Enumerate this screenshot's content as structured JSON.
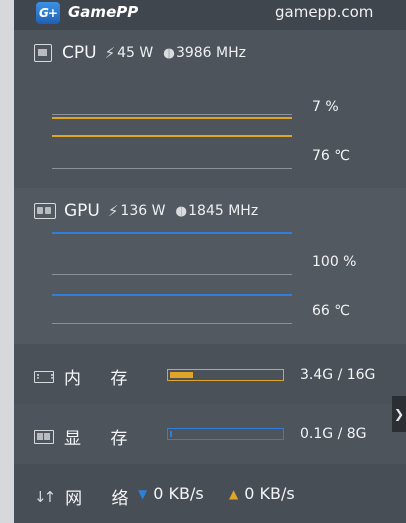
{
  "header": {
    "logo_badge": "G+",
    "logo_text": "GamePP",
    "site": "gamepp.com"
  },
  "cpu": {
    "label": "CPU",
    "power": "45 W",
    "clock": "3986 MHz",
    "usage_text": "7 %",
    "temp_text": "76 ℃",
    "usage_color": "#e0a427",
    "temp_color": "#e0a427"
  },
  "gpu": {
    "label": "GPU",
    "power": "136 W",
    "clock": "1845 MHz",
    "usage_text": "100 %",
    "temp_text": "66 ℃",
    "usage_color": "#2f7fd6",
    "temp_color": "#2f7fd6"
  },
  "memory": {
    "label": "内 存",
    "usage_text": "3.4G / 16G",
    "used_fraction": 0.2125,
    "bar_color": "#e0a427"
  },
  "vram": {
    "label": "显 存",
    "usage_text": "0.1G / 8G",
    "used_fraction": 0.0125,
    "bar_color": "#2f7fd6"
  },
  "network": {
    "label": "网 络",
    "download": "0 KB/s",
    "upload": "0 KB/s",
    "download_icon": "arrow-down-icon",
    "upload_icon": "arrow-up-icon"
  },
  "collapse": {
    "icon": "chevron-right-icon",
    "glyph": "❯"
  }
}
